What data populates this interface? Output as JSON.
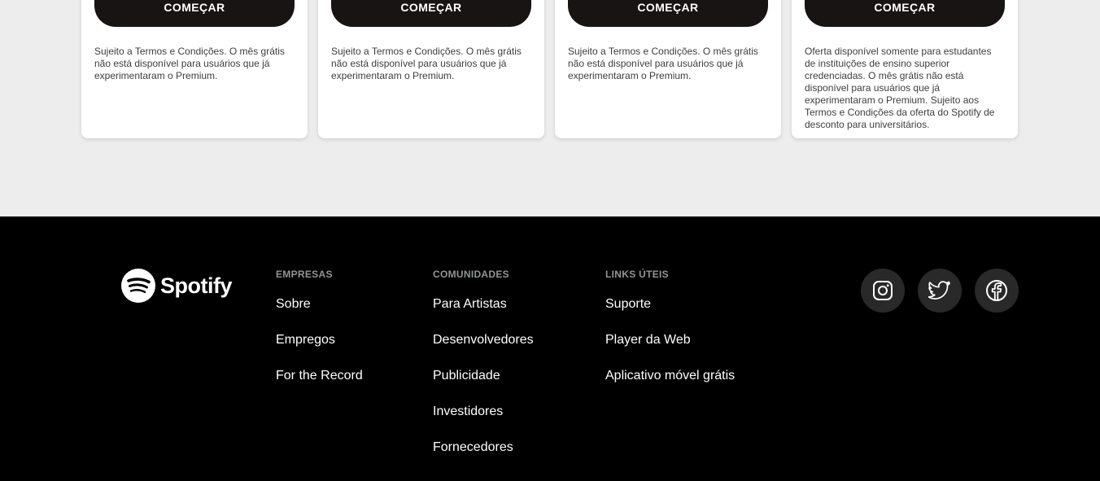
{
  "plans": [
    {
      "button_label": "COMEÇAR",
      "terms": "Sujeito a Termos e Condições. O mês grátis não está disponível para usuários que já experimentaram o Premium."
    },
    {
      "button_label": "COMEÇAR",
      "terms": "Sujeito a Termos e Condições. O mês grátis não está disponível para usuários que já experimentaram o Premium."
    },
    {
      "button_label": "COMEÇAR",
      "terms": "Sujeito a Termos e Condições. O mês grátis não está disponível para usuários que já experimentaram o Premium."
    },
    {
      "button_label": "COMEÇAR",
      "terms": "Oferta disponível somente para estudantes de instituições de ensino superior credenciadas. O mês grátis não está disponível para usuários que já experimentaram o Premium. Sujeito aos Termos e Condições da oferta do Spotify de desconto para universitários."
    }
  ],
  "footer": {
    "logo_text": "Spotify",
    "columns": [
      {
        "title": "EMPRESAS",
        "links": [
          "Sobre",
          "Empregos",
          "For the Record"
        ]
      },
      {
        "title": "COMUNIDADES",
        "links": [
          "Para Artistas",
          "Desenvolvedores",
          "Publicidade",
          "Investidores",
          "Fornecedores"
        ]
      },
      {
        "title": "LINKS ÚTEIS",
        "links": [
          "Suporte",
          "Player da Web",
          "Aplicativo móvel grátis"
        ]
      }
    ],
    "social": [
      "instagram-icon",
      "twitter-icon",
      "facebook-icon"
    ]
  },
  "colors": {
    "button_bg": "#191414",
    "footer_bg": "#000000",
    "page_bg": "#ededed",
    "social_bg": "#292929",
    "column_title": "#919496"
  }
}
